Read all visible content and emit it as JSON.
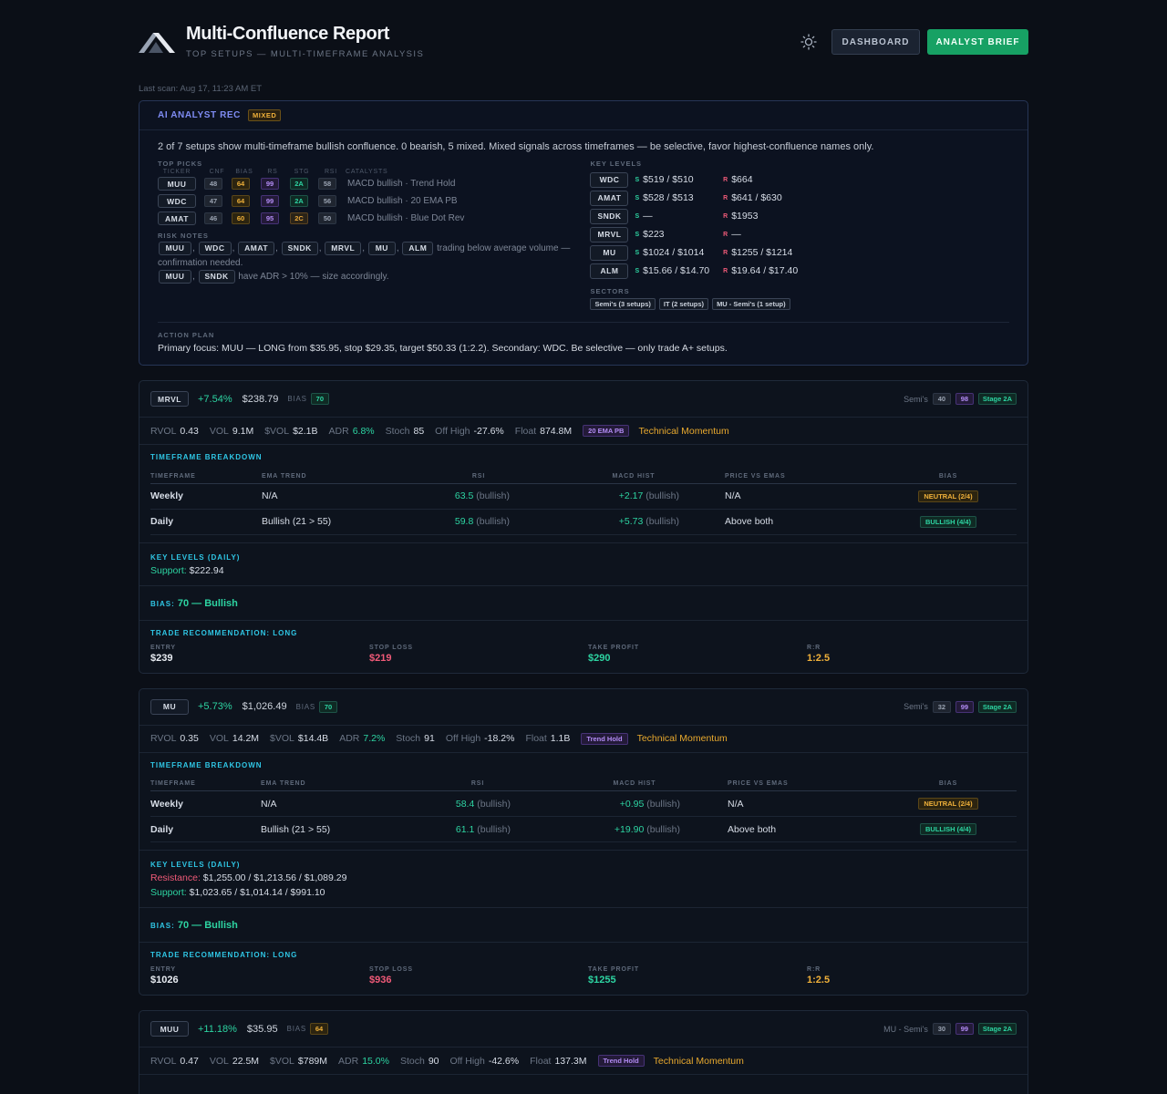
{
  "header": {
    "title": "Multi-Confluence Report",
    "subtitle": "TOP SETUPS — MULTI-TIMEFRAME ANALYSIS",
    "dashboard_label": "DASHBOARD",
    "brief_label": "ANALYST BRIEF",
    "last_scan": "Last scan: Aug 17, 11:23 AM ET"
  },
  "ai": {
    "title": "AI ANALYST REC",
    "badge": "MIXED",
    "summary": "2 of 7 setups show multi-timeframe bullish confluence. 0 bearish, 5 mixed. Mixed signals across timeframes — be selective, favor highest-confluence names only.",
    "top_picks_label": "TOP PICKS",
    "cols": [
      "TICKER",
      "CNF",
      "BIAS",
      "RS",
      "STG",
      "RSI",
      "CATALYSTS"
    ],
    "picks": [
      {
        "ticker": "MUU",
        "cnf": "48",
        "bias": "64",
        "rs": "99",
        "stg": "2A",
        "rsi": "58",
        "cat": "MACD bullish · Trend Hold"
      },
      {
        "ticker": "WDC",
        "cnf": "47",
        "bias": "64",
        "rs": "99",
        "stg": "2A",
        "rsi": "56",
        "cat": "MACD bullish · 20 EMA PB"
      },
      {
        "ticker": "AMAT",
        "cnf": "46",
        "bias": "60",
        "rs": "95",
        "stg": "2C",
        "rsi": "50",
        "cat": "MACD bullish · Blue Dot Rev"
      }
    ],
    "risk_label": "RISK NOTES",
    "risk_tickers_1": [
      "MUU",
      "WDC",
      "AMAT",
      "SNDK",
      "MRVL",
      "MU",
      "ALM"
    ],
    "risk_text_1": "trading below average volume — confirmation needed.",
    "risk_tickers_2": [
      "MUU",
      "SNDK"
    ],
    "risk_text_2": "have ADR > 10% — size accordingly.",
    "key_levels_label": "KEY LEVELS",
    "levels": [
      {
        "ticker": "WDC",
        "s": "$519 / $510",
        "r": "$664"
      },
      {
        "ticker": "AMAT",
        "s": "$528 / $513",
        "r": "$641 / $630"
      },
      {
        "ticker": "SNDK",
        "s": "—",
        "r": "$1953"
      },
      {
        "ticker": "MRVL",
        "s": "$223",
        "r": "—"
      },
      {
        "ticker": "MU",
        "s": "$1024 / $1014",
        "r": "$1255 / $1214"
      },
      {
        "ticker": "ALM",
        "s": "$15.66 / $14.70",
        "r": "$19.64 / $17.40"
      }
    ],
    "s_label": "S",
    "r_label": "R",
    "sectors_label": "SECTORS",
    "sectors": [
      "Semi's (3 setups)",
      "IT (2 setups)",
      "MU - Semi's (1 setup)"
    ],
    "plan_label": "ACTION PLAN",
    "plan": "Primary focus: MUU — LONG from $35.95, stop $29.35, target $50.33 (1:2.2). Secondary: WDC. Be selective — only trade A+ setups."
  },
  "labels": {
    "bias": "BIAS",
    "rvol": "RVOL",
    "vol": "VOL",
    "svol": "$VOL",
    "adr": "ADR",
    "stoch": "Stoch",
    "offhigh": "Off High",
    "float": "Float",
    "tf_breakdown": "TIMEFRAME BREAKDOWN",
    "th": [
      "TIMEFRAME",
      "EMA TREND",
      "RSI",
      "MACD HIST",
      "PRICE VS EMAS",
      "BIAS"
    ],
    "key_levels_daily": "KEY LEVELS (DAILY)",
    "support": "Support:",
    "resistance": "Resistance:",
    "bias_prefix": "BIAS:",
    "trade_rec": "TRADE RECOMMENDATION: LONG",
    "entry": "ENTRY",
    "stop": "STOP LOSS",
    "tp": "TAKE PROFIT",
    "rr": "R:R"
  },
  "stocks": [
    {
      "ticker": "MRVL",
      "change": "+7.54%",
      "price": "$238.79",
      "bias": "70",
      "sector": "Semi's",
      "n1": "40",
      "n2": "98",
      "stage": "Stage 2A",
      "rvol": "0.43",
      "vol": "9.1M",
      "svol": "$2.1B",
      "adr": "6.8%",
      "stoch": "85",
      "offhigh": "-27.6%",
      "float": "874.8M",
      "signal": "20 EMA PB",
      "theme": "Technical Momentum",
      "rows": [
        {
          "tf": "Weekly",
          "ema": "N/A",
          "rsi": "63.5",
          "rsi_t": "(bullish)",
          "macd": "+2.17",
          "macd_t": "(bullish)",
          "pve": "N/A",
          "bias": "NEUTRAL (2/4)"
        },
        {
          "tf": "Daily",
          "ema": "Bullish (21 > 55)",
          "rsi": "59.8",
          "rsi_t": "(bullish)",
          "macd": "+5.73",
          "macd_t": "(bullish)",
          "pve": "Above both",
          "bias": "BULLISH (4/4)"
        }
      ],
      "resistance": "",
      "support": "$222.94",
      "bias_text": "70 — Bullish",
      "entry": "$239",
      "stop": "$219",
      "tp": "$290",
      "rr": "1:2.5"
    },
    {
      "ticker": "MU",
      "change": "+5.73%",
      "price": "$1,026.49",
      "bias": "70",
      "sector": "Semi's",
      "n1": "32",
      "n2": "99",
      "stage": "Stage 2A",
      "rvol": "0.35",
      "vol": "14.2M",
      "svol": "$14.4B",
      "adr": "7.2%",
      "stoch": "91",
      "offhigh": "-18.2%",
      "float": "1.1B",
      "signal": "Trend Hold",
      "theme": "Technical Momentum",
      "rows": [
        {
          "tf": "Weekly",
          "ema": "N/A",
          "rsi": "58.4",
          "rsi_t": "(bullish)",
          "macd": "+0.95",
          "macd_t": "(bullish)",
          "pve": "N/A",
          "bias": "NEUTRAL (2/4)"
        },
        {
          "tf": "Daily",
          "ema": "Bullish (21 > 55)",
          "rsi": "61.1",
          "rsi_t": "(bullish)",
          "macd": "+19.90",
          "macd_t": "(bullish)",
          "pve": "Above both",
          "bias": "BULLISH (4/4)"
        }
      ],
      "resistance": "$1,255.00 / $1,213.56 / $1,089.29",
      "support": "$1,023.65 / $1,014.14 / $991.10",
      "bias_text": "70 — Bullish",
      "entry": "$1026",
      "stop": "$936",
      "tp": "$1255",
      "rr": "1:2.5"
    },
    {
      "ticker": "MUU",
      "change": "+11.18%",
      "price": "$35.95",
      "bias": "64",
      "sector": "MU - Semi's",
      "n1": "30",
      "n2": "99",
      "stage": "Stage 2A",
      "rvol": "0.47",
      "vol": "22.5M",
      "svol": "$789M",
      "adr": "15.0%",
      "stoch": "90",
      "offhigh": "-42.6%",
      "float": "137.3M",
      "signal": "Trend Hold",
      "theme": "Technical Momentum"
    }
  ]
}
